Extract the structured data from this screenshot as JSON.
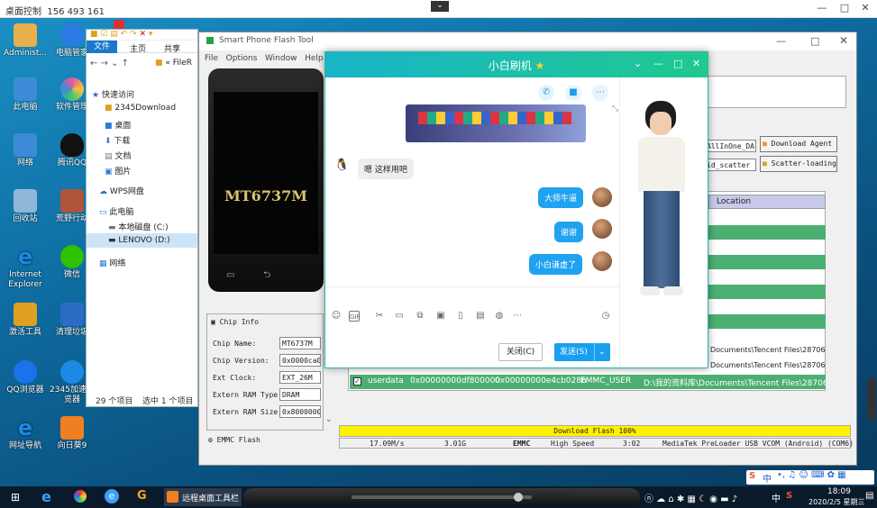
{
  "remote": {
    "title": "桌面控制",
    "id": "156 493 161",
    "min": "—",
    "restore": "□",
    "close": "✕",
    "collapse": "⌄"
  },
  "desktop_icons": [
    {
      "label": "Administ...",
      "color": "#e8b04a"
    },
    {
      "label": "电脑管家",
      "color": "#2c7be5"
    },
    {
      "label": "此电脑",
      "color": "#3d8bd6"
    },
    {
      "label": "软件管理",
      "color": "#e05aa0"
    },
    {
      "label": "网络",
      "color": "#3d8bd6"
    },
    {
      "label": "腾讯QQ",
      "color": "#111111"
    },
    {
      "label": "回收站",
      "color": "#8fb7d8"
    },
    {
      "label": "荒野行动",
      "color": "#b0543a"
    },
    {
      "label": "Internet Explorer",
      "color": "#1e88e5"
    },
    {
      "label": "微信",
      "color": "#2dc100"
    },
    {
      "label": "激活工具",
      "color": "#e0a020"
    },
    {
      "label": "清理垃圾",
      "color": "#2b6cc4"
    },
    {
      "label": "QQ浏览器",
      "color": "#1a73e8"
    },
    {
      "label": "2345加速浏览器",
      "color": "#1e88e5"
    },
    {
      "label": "网址导航",
      "color": "#1e88e5"
    },
    {
      "label": "向日葵9",
      "color": "#f07f22"
    }
  ],
  "explorer": {
    "tabs": [
      "文件",
      "主页",
      "共享"
    ],
    "path": "FileR",
    "items": [
      "快速访问",
      "2345Download",
      "桌面",
      "下载",
      "文档",
      "图片",
      "WPS网盘",
      "此电脑",
      "本地磁盘 (C:)",
      "LENOVO (D:)",
      "网络"
    ],
    "status_count": "29 个项目",
    "status_selected": "选中 1 个项目"
  },
  "flash": {
    "title": "Smart Phone Flash Tool",
    "menu": [
      "File",
      "Options",
      "Window",
      "Help"
    ],
    "device_label": "MT6737M",
    "download_agent_value": "AllInOne_DA.bin",
    "download_agent_btn": "Download Agent",
    "scatter_value": "id_scatter",
    "scatter_btn": "Scatter-loading",
    "location_header": "Location",
    "chip_title": "Chip Info",
    "chip": [
      {
        "k": "Chip Name:",
        "v": "MT6737M"
      },
      {
        "k": "Chip Version:",
        "v": "0x0000ca00"
      },
      {
        "k": "Ext Clock:",
        "v": "EXT_26M"
      },
      {
        "k": "Extern RAM Type:",
        "v": "DRAM"
      },
      {
        "k": "Extern RAM Size:",
        "v": "0x80000000"
      }
    ],
    "emmc": "EMMC Flash",
    "paths": [
      "Documents\\Tencent Files\\28706...",
      "Documents\\Tencent Files\\28706..."
    ],
    "userdata": {
      "name": "userdata",
      "begin": "0x00000000df800000",
      "end": "0x00000000e4cb028b",
      "region": "EMMC_USER",
      "location": "D:\\我的资料库\\Documents\\Tencent Files\\28706..."
    },
    "progress_text": "Download Flash 100%",
    "progress": 1.0,
    "status": [
      "17.09M/s",
      "3.01G",
      "EMMC",
      "High Speed",
      "3:02",
      "MediaTek PreLoader USB VCOM (Android) (COM6)"
    ]
  },
  "chat": {
    "title": "小白刷机",
    "messages": [
      {
        "text": "嗯 这样用吧",
        "me": false
      },
      {
        "text": "大师牛逼",
        "me": true
      },
      {
        "text": "谢谢",
        "me": true
      },
      {
        "text": "小白谦虚了",
        "me": true
      }
    ],
    "close_btn": "关闭(C)",
    "send_btn": "发送(S)"
  },
  "taskbar": {
    "remote_app": "远程桌面工具栏",
    "time": "18:09",
    "date": "2020/2/5 星期三",
    "ime": "中",
    "ime2": "中"
  }
}
